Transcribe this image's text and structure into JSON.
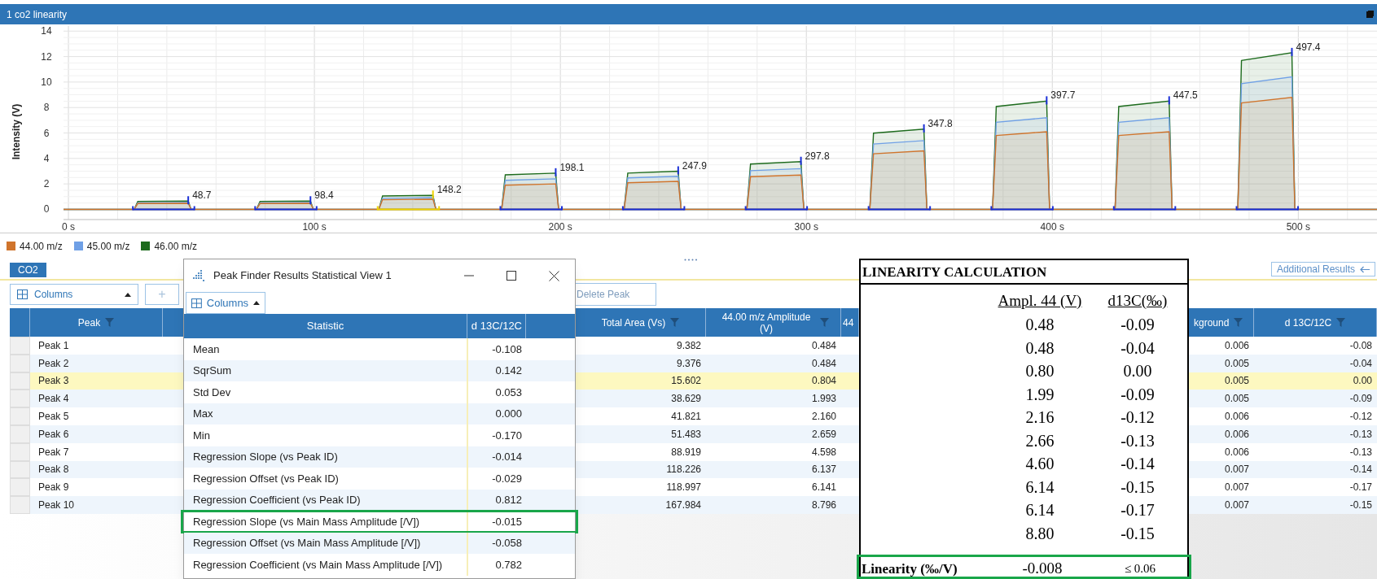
{
  "window": {
    "title": "1 co2 linearity"
  },
  "chart": {
    "chart_data": {
      "type": "area",
      "grid": true,
      "ylabel": "Intensity (V)",
      "xlim": [
        -2,
        532
      ],
      "ylim": [
        -0.8,
        14.4
      ],
      "xticks": [
        {
          "value": 0,
          "label": "0 s"
        },
        {
          "value": 100,
          "label": "100 s"
        },
        {
          "value": 200,
          "label": "200 s"
        },
        {
          "value": 300,
          "label": "300 s"
        },
        {
          "value": 400,
          "label": "400 s"
        },
        {
          "value": 500,
          "label": "500 s"
        }
      ],
      "yticks": [
        0,
        2,
        4,
        6,
        8,
        10,
        12,
        14
      ],
      "x": [
        -2,
        26.7,
        28.2,
        48.7,
        49.9,
        76.4,
        77.9,
        98.4,
        99.6,
        126.2,
        127.7,
        148.2,
        149.4,
        176.1,
        177.6,
        198.1,
        199.3,
        225.9,
        227.4,
        247.9,
        249.1,
        275.8,
        277.3,
        297.8,
        299,
        325.8,
        327.3,
        347.8,
        349,
        375.7,
        377.2,
        397.7,
        398.9,
        425.5,
        427,
        447.5,
        448.7,
        475.4,
        476.9,
        497.4,
        498.6,
        532
      ],
      "series": [
        {
          "name": "44.00 m/z",
          "color": "#d0742c",
          "values": [
            0,
            0,
            0.46,
            0.48,
            0,
            0,
            0.46,
            0.48,
            0,
            0,
            0.76,
            0.8,
            0,
            0,
            1.9,
            2.0,
            0,
            0,
            2.09,
            2.2,
            0,
            0,
            2.57,
            2.7,
            0,
            0,
            4.37,
            4.6,
            0,
            0,
            5.8,
            6.1,
            0,
            0,
            5.8,
            6.1,
            0,
            0,
            8.36,
            8.8,
            0,
            0
          ]
        },
        {
          "name": "45.00 m/z",
          "color": "#6fa0e6",
          "values": [
            0,
            0,
            0.52,
            0.55,
            0,
            0,
            0.52,
            0.55,
            0,
            0,
            0.87,
            0.92,
            0,
            0,
            2.28,
            2.4,
            0,
            0,
            2.47,
            2.6,
            0,
            0,
            3.04,
            3.2,
            0,
            0,
            5.13,
            5.4,
            0,
            0,
            6.84,
            7.2,
            0,
            0,
            6.84,
            7.2,
            0,
            0,
            9.88,
            10.4,
            0,
            0
          ]
        },
        {
          "name": "46.00 m/z",
          "color": "#1d6b1d",
          "values": [
            0,
            0,
            0.62,
            0.65,
            0,
            0,
            0.62,
            0.65,
            0,
            0,
            1.05,
            1.1,
            0,
            0,
            2.71,
            2.85,
            0,
            0,
            2.85,
            3.0,
            0,
            0,
            3.56,
            3.75,
            0,
            0,
            5.99,
            6.3,
            0,
            0,
            8.08,
            8.5,
            0,
            0,
            8.08,
            8.5,
            0,
            0,
            11.69,
            12.3,
            0,
            0
          ]
        }
      ],
      "annotations": [
        {
          "x": 48.7,
          "y": 0.65,
          "text": "48.7"
        },
        {
          "x": 98.4,
          "y": 0.65,
          "text": "98.4"
        },
        {
          "x": 148.2,
          "y": 1.1,
          "text": "148.2"
        },
        {
          "x": 198.1,
          "y": 2.85,
          "text": "198.1"
        },
        {
          "x": 247.9,
          "y": 3.0,
          "text": "247.9"
        },
        {
          "x": 297.8,
          "y": 3.75,
          "text": "297.8"
        },
        {
          "x": 347.8,
          "y": 6.3,
          "text": "347.8"
        },
        {
          "x": 397.7,
          "y": 8.5,
          "text": "397.7"
        },
        {
          "x": 447.5,
          "y": 8.5,
          "text": "447.5"
        },
        {
          "x": 497.4,
          "y": 12.3,
          "text": "497.4"
        }
      ]
    }
  },
  "tabs": [
    {
      "label": "CO2",
      "selected": true
    }
  ],
  "additional_results": "Additional Results",
  "toolbar": {
    "columns": "Columns",
    "add": "+",
    "delete": {
      "label": "Delete Peak",
      "disabled": true
    }
  },
  "table": {
    "columns": [
      {
        "label": "Peak",
        "filter": true
      },
      {
        "label": "Total Area (Vs)",
        "filter": true
      },
      {
        "label": "44.00 m/z Amplitude (V)",
        "filter": true
      },
      {
        "label": "44",
        "filter": false
      },
      {
        "label": "kground",
        "filter": true
      },
      {
        "label": "d 13C/12C",
        "filter": true
      }
    ],
    "rows": [
      {
        "selected": false,
        "cells": [
          "Peak 1",
          "9.382",
          "0.484",
          "0.006",
          "-0.08"
        ]
      },
      {
        "selected": false,
        "cells": [
          "Peak 2",
          "9.376",
          "0.484",
          "0.005",
          "-0.04"
        ]
      },
      {
        "selected": true,
        "cells": [
          "Peak 3",
          "15.602",
          "0.804",
          "0.005",
          "0.00"
        ]
      },
      {
        "selected": false,
        "cells": [
          "Peak 4",
          "38.629",
          "1.993",
          "0.005",
          "-0.09"
        ]
      },
      {
        "selected": false,
        "cells": [
          "Peak 5",
          "41.821",
          "2.160",
          "0.006",
          "-0.12"
        ]
      },
      {
        "selected": false,
        "cells": [
          "Peak 6",
          "51.483",
          "2.659",
          "0.006",
          "-0.13"
        ]
      },
      {
        "selected": false,
        "cells": [
          "Peak 7",
          "88.919",
          "4.598",
          "0.006",
          "-0.13"
        ]
      },
      {
        "selected": false,
        "cells": [
          "Peak 8",
          "118.226",
          "6.137",
          "0.007",
          "-0.14"
        ]
      },
      {
        "selected": false,
        "cells": [
          "Peak 9",
          "118.997",
          "6.141",
          "0.007",
          "-0.17"
        ]
      },
      {
        "selected": false,
        "cells": [
          "Peak 10",
          "167.984",
          "8.796",
          "0.007",
          "-0.15"
        ]
      }
    ]
  },
  "stat_window": {
    "title": "Peak Finder Results Statistical View 1",
    "columns_button": "Columns",
    "columns": [
      "Statistic",
      "d 13C/12C"
    ],
    "rows": [
      {
        "statistic": "Mean",
        "value": "-0.108",
        "highlighted": false
      },
      {
        "statistic": "SqrSum",
        "value": "0.142",
        "highlighted": false
      },
      {
        "statistic": "Std Dev",
        "value": "0.053",
        "highlighted": false
      },
      {
        "statistic": "Max",
        "value": "0.000",
        "highlighted": false
      },
      {
        "statistic": "Min",
        "value": "-0.170",
        "highlighted": false
      },
      {
        "statistic": "Regression Slope (vs Peak ID)",
        "value": "-0.014",
        "highlighted": false
      },
      {
        "statistic": "Regression Offset (vs Peak ID)",
        "value": "-0.029",
        "highlighted": false
      },
      {
        "statistic": "Regression Coefficient (vs Peak ID)",
        "value": "0.812",
        "highlighted": false
      },
      {
        "statistic": "Regression Slope (vs Main Mass Amplitude [/V])",
        "value": "-0.015",
        "highlighted": true
      },
      {
        "statistic": "Regression Offset (vs Main Mass Amplitude [/V])",
        "value": "-0.058",
        "highlighted": false
      },
      {
        "statistic": "Regression Coefficient (vs Main Mass Amplitude [/V])",
        "value": "0.782",
        "highlighted": false
      }
    ]
  },
  "linearity": {
    "title": "LINEARITY CALCULATION",
    "columns": [
      "Ampl. 44 (V)",
      "d13C(‰)"
    ],
    "rows": [
      [
        "0.48",
        "-0.09"
      ],
      [
        "0.48",
        "-0.04"
      ],
      [
        "0.80",
        "0.00"
      ],
      [
        "1.99",
        "-0.09"
      ],
      [
        "2.16",
        "-0.12"
      ],
      [
        "2.66",
        "-0.13"
      ],
      [
        "4.60",
        "-0.14"
      ],
      [
        "6.14",
        "-0.15"
      ],
      [
        "6.14",
        "-0.17"
      ],
      [
        "8.80",
        "-0.15"
      ]
    ],
    "result": {
      "label": "Linearity (‰/V)",
      "value": "-0.008",
      "limit": "≤ 0.06",
      "highlighted": true
    }
  }
}
